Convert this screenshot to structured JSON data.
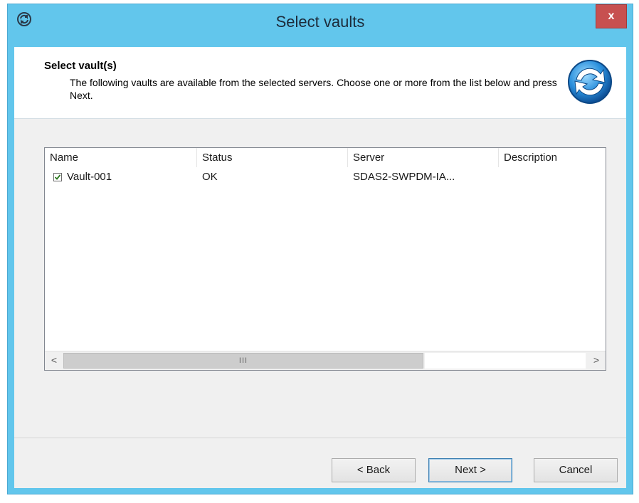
{
  "window": {
    "title": "Select vaults",
    "close_label": "x",
    "accent_color": "#62c6ec",
    "close_color": "#c75050"
  },
  "header": {
    "title": "Select vault(s)",
    "description": "The following vaults are available from the selected servers. Choose one or more from the list below and press Next.",
    "icon": "refresh-arrows-icon"
  },
  "list": {
    "columns": [
      "Name",
      "Status",
      "Server",
      "Description"
    ],
    "rows": [
      {
        "checked": true,
        "name": "Vault-001",
        "status": "OK",
        "server": "SDAS2-SWPDM-IA...",
        "description": ""
      }
    ],
    "scrollbar": {
      "left_arrow": "<",
      "right_arrow": ">",
      "thumb_grip": "III"
    }
  },
  "buttons": {
    "back": "< Back",
    "next": "Next >",
    "cancel": "Cancel"
  }
}
